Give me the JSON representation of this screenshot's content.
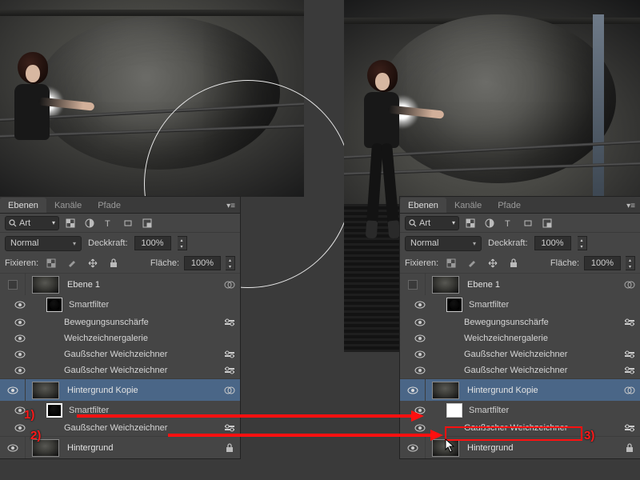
{
  "tabs": {
    "layers": "Ebenen",
    "channels": "Kanäle",
    "paths": "Pfade"
  },
  "search": {
    "placeholder": "Art"
  },
  "blend_mode": "Normal",
  "opacity_label": "Deckkraft:",
  "opacity_value": "100%",
  "lock_label": "Fixieren:",
  "fill_label": "Fläche:",
  "fill_value": "100%",
  "layers_list": {
    "layer1": "Ebene 1",
    "smartfilter": "Smartfilter",
    "filters": [
      "Bewegungsunschärfe",
      "Weichzeichnergalerie",
      "Gaußscher Weichzeichner",
      "Gaußscher Weichzeichner"
    ],
    "bg_copy": "Hintergrund Kopie",
    "smartfilter2": "Smartfilter",
    "gauss2": "Gaußscher Weichzeichner",
    "background": "Hintergrund"
  },
  "annotations": {
    "n1": "1)",
    "n2": "2)",
    "n3": "3)"
  }
}
